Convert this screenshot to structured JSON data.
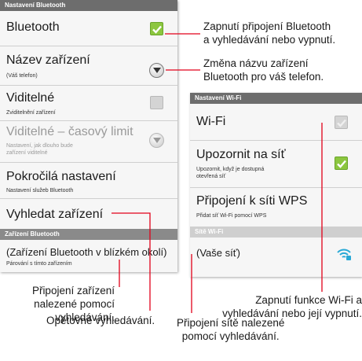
{
  "bluetooth_panel": {
    "header": "Nastavení Bluetooth",
    "items": [
      {
        "title": "Bluetooth",
        "subtitle": "",
        "control": "checkbox-checked"
      },
      {
        "title": "Název zařízení",
        "subtitle": "(Váš telefon)",
        "control": "dropdown"
      },
      {
        "title": "Viditelné",
        "subtitle": "Zviditelnění zařízení",
        "control": "checkbox-unchecked"
      },
      {
        "title": "Viditelné – časový limit",
        "subtitle_line1": "Nastavení, jak dlouho bude",
        "subtitle_line2": "zařízení viditelné",
        "control": "dropdown-disabled"
      },
      {
        "title": "Pokročilá nastavení",
        "subtitle": "Nastavení služeb Bluetooth"
      },
      {
        "title": "Vyhledat zařízení",
        "subtitle": ""
      }
    ],
    "devices_header": "Zařízení Bluetooth",
    "device": {
      "title": "(Zařízení Bluetooth v blízkém okolí)",
      "subtitle": "Párování s tímto zařízením"
    }
  },
  "wifi_panel": {
    "header": "Nastavení Wi-Fi",
    "items": [
      {
        "title": "Wi-Fi",
        "subtitle": "",
        "control": "checkbox-unchecked"
      },
      {
        "title": "Upozornit na síť",
        "subtitle_line1": "Upozornit, když je dostupná",
        "subtitle_line2": "otevřená síť",
        "control": "checkbox-checked"
      },
      {
        "title": "Připojení k síti WPS",
        "subtitle": "Přidat síť Wi-Fi pomocí WPS"
      }
    ],
    "networks_header": "Sítě Wi-Fi",
    "network": {
      "title": "(Vaše síť)",
      "icon": "wifi-signal-icon"
    }
  },
  "callouts": {
    "bluetooth_toggle": [
      "Zapnutí připojení Bluetooth",
      "a vyhledávání nebo vypnutí."
    ],
    "rename": [
      "Změna názvu zařízení",
      "Bluetooth pro váš telefon."
    ],
    "pair": [
      "Připojení zařízení",
      "nalezené pomocí",
      "vyhledávání."
    ],
    "rescan": [
      "Opětovné vyhledávání."
    ],
    "wifi_toggle": [
      "Zapnutí funkce Wi-Fi a",
      "vyhledávání nebo její vypnutí."
    ],
    "connect_network": [
      "Připojení sítě nalezené",
      "pomocí vyhledávání."
    ]
  },
  "colors": {
    "accent_line": "#e2001a",
    "checkbox_green": "#8cc63f",
    "header_gray": "#6d6d6d"
  }
}
